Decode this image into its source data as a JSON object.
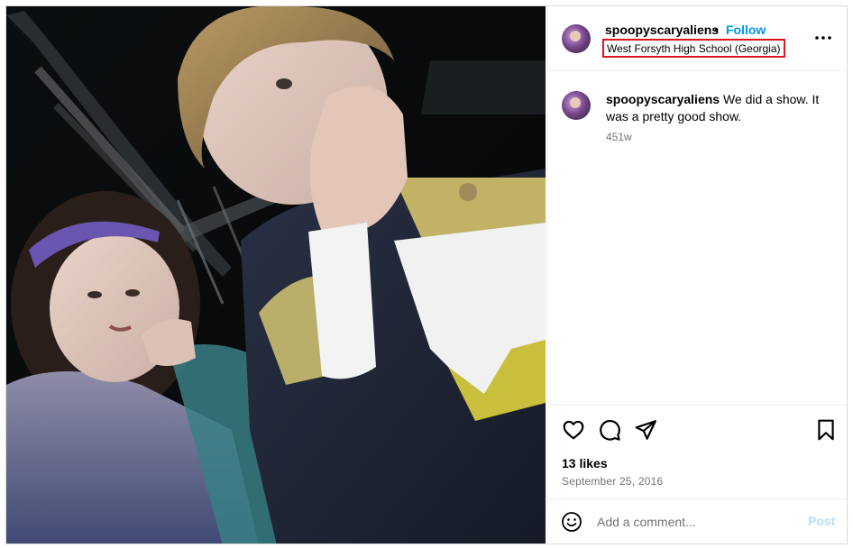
{
  "post": {
    "photo_alt": "",
    "author": {
      "username": "spoopyscaryaliens",
      "separator": "•",
      "follow_label": "Follow",
      "location": "West Forsyth High School (Georgia)"
    },
    "menu_icon": "more-horizontal-icon",
    "caption": {
      "username": "spoopyscaryaliens",
      "text": "We did a show. It was a pretty good show.",
      "age": "451w"
    },
    "actions": {
      "icons": [
        "heart-icon",
        "comment-icon",
        "share-icon",
        "bookmark-icon"
      ]
    },
    "likes": "13 likes",
    "date": "September 25, 2016",
    "add_comment": {
      "emoji_icon": "emoji-icon",
      "placeholder": "Add a comment...",
      "post_label": "Post"
    },
    "colors": {
      "follow": "#0095f6",
      "post_disabled": "#b2dffc",
      "location_highlight": "#e0141e",
      "secondary_text": "#737373"
    }
  }
}
